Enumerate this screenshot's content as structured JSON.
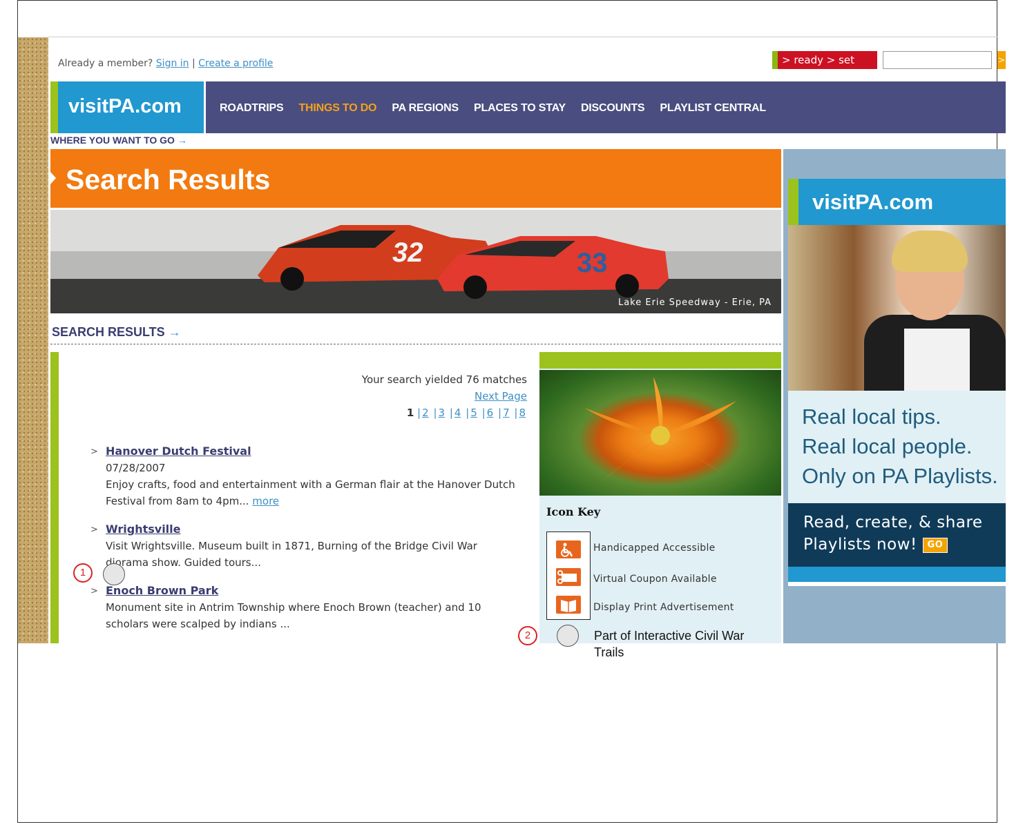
{
  "header": {
    "member_prefix": "Already a member?",
    "sign_in": "Sign in",
    "separator": "|",
    "create_profile": "Create a profile",
    "ready_set": "> ready  > set",
    "search_value": "",
    "go_glyph": ">"
  },
  "logo": "visitPA.com",
  "nav": [
    "ROADTRIPS",
    "THINGS TO DO",
    "PA REGIONS",
    "PLACES TO STAY",
    "DISCOUNTS",
    "PLAYLIST CENTRAL"
  ],
  "nav_active": "THINGS TO DO",
  "where_label": "WHERE YOU WANT TO GO",
  "arrow": "→",
  "hero_title": "Search Results",
  "banner_caption": "Lake Erie Speedway - Erie, PA",
  "section_head": "SEARCH RESULTS",
  "summary": {
    "yield_text": "Your search yielded 76 matches",
    "next_page": "Next Page",
    "current_page": "1",
    "pages": [
      "2",
      "3",
      "4",
      "5",
      "6",
      "7",
      "8"
    ]
  },
  "results": [
    {
      "title": "Hanover Dutch Festival",
      "date": "07/28/2007",
      "desc": "Enjoy crafts, food and entertainment with a German flair at the Hanover Dutch Festival from 8am to 4pm...",
      "more": "more"
    },
    {
      "title": "Wrightsville",
      "desc": "Visit Wrightsville. Museum built in 1871, Burning of the Bridge Civil War diorama show. Guided tours..."
    },
    {
      "title": "Enoch Brown Park",
      "desc": "Monument site in Antrim Township where Enoch Brown (teacher) and 10 scholars were scalped by indians ..."
    }
  ],
  "icon_key": {
    "title": "Icon Key",
    "items": [
      {
        "label": "Handicapped Accessible",
        "icon": "wheelchair-icon"
      },
      {
        "label": "Virtual Coupon Available",
        "icon": "coupon-icon"
      },
      {
        "label": "Display Print Advertisement",
        "icon": "print-ad-icon"
      }
    ]
  },
  "ad": {
    "logo": "visitPA.com",
    "lines": [
      "Real local tips.",
      "Real local people.",
      "Only on PA Playlists."
    ],
    "cta_line1": "Read, create, & share",
    "cta_line2": "Playlists now!",
    "go": "GO"
  },
  "annotations": {
    "marker1": "1",
    "marker2": "2",
    "note": "Part of Interactive Civil War Trails"
  },
  "colors": {
    "nav_bg": "#4a4d7f",
    "logo_blue": "#2198cf",
    "accent_green": "#9cc21d",
    "orange": "#f27a10",
    "link": "#3d8fc6",
    "ready_red": "#cc1122"
  }
}
